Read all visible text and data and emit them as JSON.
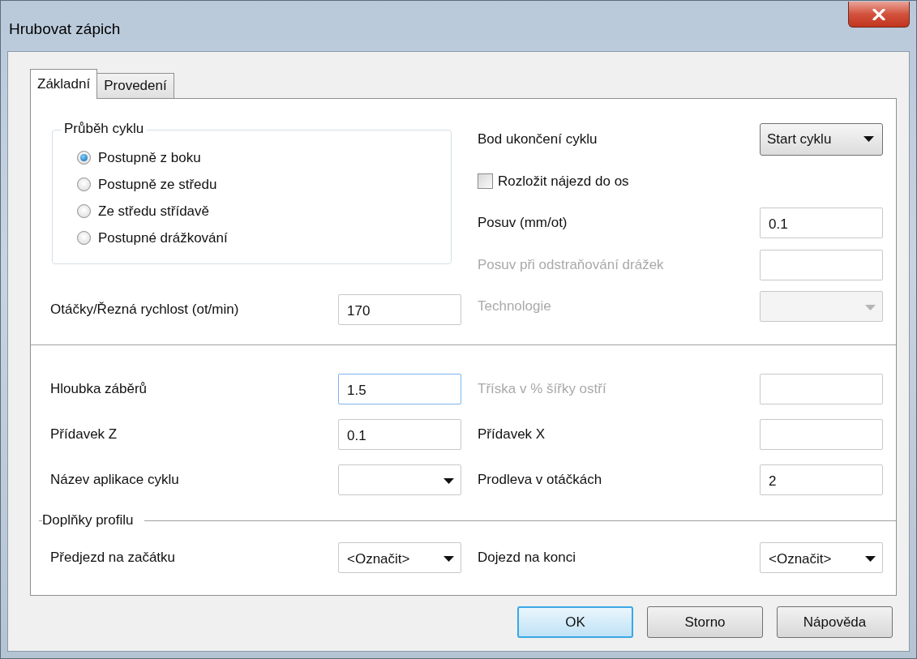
{
  "window": {
    "title": "Hrubovat zápich"
  },
  "tabs": [
    {
      "label": "Základní",
      "selected": true
    },
    {
      "label": "Provedení",
      "selected": false
    }
  ],
  "cycle_group": {
    "title": "Průběh cyklu",
    "options": [
      {
        "label": "Postupně z boku",
        "selected": true
      },
      {
        "label": "Postupně ze středu",
        "selected": false
      },
      {
        "label": "Ze středu střídavě",
        "selected": false
      },
      {
        "label": "Postupné drážkování",
        "selected": false
      }
    ]
  },
  "speed": {
    "label": "Otáčky/Řezná rychlost (ot/min)",
    "value": "170"
  },
  "upper_right": [
    {
      "kind": "button_combo",
      "label": "Bod ukončení cyklu",
      "value": "Start cyklu",
      "disabled": false
    },
    {
      "kind": "checkbox",
      "label": "Rozložit nájezd do os",
      "checked": false,
      "disabled": false
    },
    {
      "kind": "text",
      "label": "Posuv (mm/ot)",
      "value": "0.1",
      "disabled": false
    },
    {
      "kind": "text",
      "label": "Posuv při odstraňování drážek",
      "disabled": true
    },
    {
      "kind": "combo",
      "label": "Technologie",
      "disabled": true
    }
  ],
  "parameters": [
    {
      "kind": "text",
      "label": "Hloubka záběrů",
      "value": "1.5",
      "disabled": false,
      "focused": true
    },
    {
      "kind": "text",
      "label": "Tříska v % šířky ostří",
      "disabled": true,
      "focused": false
    },
    {
      "kind": "text",
      "label": "Přídavek Z",
      "value": "0.1",
      "disabled": false,
      "focused": false
    },
    {
      "kind": "text",
      "label": "Přídavek X",
      "disabled": false,
      "focused": false
    },
    {
      "kind": "combo",
      "label": "Název aplikace cyklu",
      "disabled": false,
      "focused": false
    },
    {
      "kind": "text",
      "label": "Prodleva v otáčkách",
      "value": "2",
      "disabled": false,
      "focused": false
    }
  ],
  "profile_extras": {
    "title": "Doplňky profilu",
    "items": [
      {
        "kind": "combo",
        "label": "Předjezd na začátku",
        "value": "<Označit>"
      },
      {
        "kind": "combo",
        "label": "Dojezd na konci",
        "value": "<Označit>"
      }
    ]
  },
  "buttons": [
    {
      "label": "OK",
      "default": true
    },
    {
      "label": "Storno",
      "default": false
    },
    {
      "label": "Nápověda",
      "default": false
    }
  ]
}
